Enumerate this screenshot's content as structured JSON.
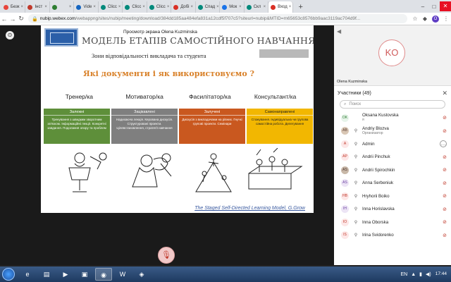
{
  "browser": {
    "tabs": [
      {
        "label": "Безк",
        "color": "#e8453c"
      },
      {
        "label": "Інст",
        "color": "#c0392b"
      },
      {
        "label": "",
        "color": "#2e7d32"
      },
      {
        "label": "Vide",
        "color": "#1565c0"
      },
      {
        "label": "Clicc",
        "color": "#00897b"
      },
      {
        "label": "Clicc",
        "color": "#00897b"
      },
      {
        "label": "Clicc",
        "color": "#00897b"
      },
      {
        "label": "Добі",
        "color": "#d93025"
      },
      {
        "label": "Спад",
        "color": "#00897b"
      },
      {
        "label": "Мок",
        "color": "#1a73e8"
      },
      {
        "label": "Скл",
        "color": "#00897b"
      },
      {
        "label": "Вход",
        "color": "#d93025"
      }
    ],
    "url_domain": "nubip.webex.com",
    "url_path": "/webappng/sites/nubip/meeting/download/384dd185aa484efa831a12cdf5f707c5?siteurl=nubip&MTID=m65653c8576bb9aac3119ac704d9f...",
    "profile_initial": "O"
  },
  "stage": {
    "share_label": "Просмотр экрана Olena Kuzminska"
  },
  "slide": {
    "title": "МОДЕЛЬ ЕТАПІВ САМОСТІЙНОГО НАВЧАННЯ",
    "subtitle": "Зони відповідальності викладача та студента",
    "question": "Які документи і як використовуємо ?",
    "roles": [
      "Тренер/ка",
      "Мотиватор/ка",
      "Фасилітатор/ка",
      "Консультант/ка"
    ],
    "cards": [
      {
        "head": "Залежні",
        "body": "Тренування з швидким зворотним зв'язком. Інформаційні лекції. Конкретні завдання. Подолання опору та проблем"
      },
      {
        "head": "Зацікавлені",
        "body": "Надихаюча лекція. Керована дискусія. Структуровані проекти. Цілевстановлення, стратегії навчання"
      },
      {
        "head": "Залучені",
        "body": "Дискусія з викладачами на рівних. Гнучкі групові проекти. Семінари"
      },
      {
        "head": "Самонаправлені",
        "body": "Стажування. Індивідуальна чи групова самостійна робота. Делегування"
      }
    ],
    "footer": "The Staged Self-Directed Learning Model, G.Grow"
  },
  "panel": {
    "avatar_initials": "KO",
    "video_name": "Olena Kuzminska",
    "participants_title": "Участники (49)",
    "search_placeholder": "Поиск",
    "participants": [
      {
        "initials": "OK",
        "name": "Oksana Kustovska",
        "role": "я",
        "bg": "#e7f4ea",
        "fg": "#2e7d32"
      },
      {
        "initials": "AB",
        "name": "Andriy Blozva",
        "role": "Организатор",
        "bg": "#d9c7b5",
        "fg": "#5d4037"
      },
      {
        "initials": "A",
        "name": "Admin",
        "role": "",
        "bg": "#fde7e7",
        "fg": "#c0392b"
      },
      {
        "initials": "AP",
        "name": "Andrii Pinchuk",
        "role": "",
        "bg": "#fde7e7",
        "fg": "#c0392b"
      },
      {
        "initials": "AS",
        "name": "Andrii Spirochkin",
        "role": "",
        "bg": "#c8b8a8",
        "fg": "#4e342e"
      },
      {
        "initials": "AS",
        "name": "Anna Serbeniuk",
        "role": "",
        "bg": "#ece4f5",
        "fg": "#6a3fa0"
      },
      {
        "initials": "HB",
        "name": "Hryhorii Boiko",
        "role": "",
        "bg": "#fde7e7",
        "fg": "#c0392b"
      },
      {
        "initials": "IH",
        "name": "Inna Horislavska",
        "role": "",
        "bg": "#ece4f5",
        "fg": "#6a3fa0"
      },
      {
        "initials": "IO",
        "name": "Inna Oborska",
        "role": "",
        "bg": "#fde7e7",
        "fg": "#c0392b"
      },
      {
        "initials": "IS",
        "name": "Irina Svidorenko",
        "role": "",
        "bg": "#fde7e7",
        "fg": "#c0392b"
      }
    ]
  },
  "taskbar": {
    "lang": "EN",
    "time": "17:44"
  }
}
